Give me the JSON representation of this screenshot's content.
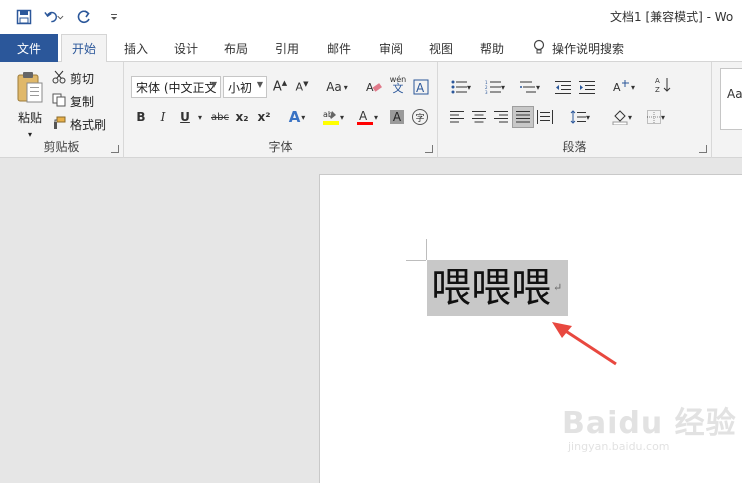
{
  "titlebar": {
    "title": "文档1 [兼容模式] - Wo",
    "qat": [
      {
        "name": "save-icon",
        "label": "save"
      },
      {
        "name": "undo-icon",
        "label": "undo"
      },
      {
        "name": "redo-icon",
        "label": "redo"
      },
      {
        "name": "customize-qat-icon",
        "label": "customize"
      }
    ]
  },
  "tabs": {
    "file": "文件",
    "items": [
      "开始",
      "插入",
      "设计",
      "布局",
      "引用",
      "邮件",
      "审阅",
      "视图",
      "帮助"
    ],
    "active": "开始",
    "tellme": "操作说明搜索"
  },
  "ribbon": {
    "clipboard": {
      "label": "剪贴板",
      "paste": "粘贴",
      "cut": "剪切",
      "copy": "复制",
      "format_painter": "格式刷"
    },
    "font": {
      "label": "字体",
      "font_name": "宋体 (中文正文",
      "font_size": "小初",
      "change_case": "Aa",
      "phonetic": "wén",
      "bold": "B",
      "italic": "I",
      "underline": "U",
      "strikethrough": "abc",
      "subscript": "x₂",
      "superscript": "x²",
      "char_shading": "A",
      "enclosed": "字"
    },
    "paragraph": {
      "label": "段落"
    },
    "styles": {
      "preview": "Aa"
    }
  },
  "document": {
    "text": "喂喂喂",
    "para_mark": "↵"
  },
  "watermark": {
    "main": "Baidu 经验",
    "sub": "jingyan.baidu.com"
  },
  "colors": {
    "accent": "#2b579a",
    "selection": "#c8c8c8",
    "arrow": "#e8483f",
    "highlight": "#ffff00",
    "font_color": "#ff0000"
  }
}
